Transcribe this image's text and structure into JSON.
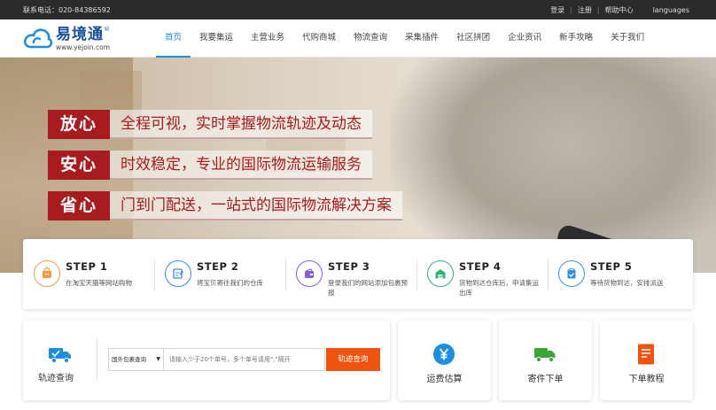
{
  "topbar": {
    "phone": "联系电话：020-84386592",
    "login": "登录",
    "register": "注册",
    "help": "帮助中心",
    "languages": "languages"
  },
  "logo": {
    "name": "易境通",
    "mark": "®",
    "url": "www.yejoin.com",
    "color": "#1c4f9c"
  },
  "nav": {
    "active_color": "#1c8fe3",
    "items": [
      {
        "label": "首页",
        "active": true
      },
      {
        "label": "我要集运"
      },
      {
        "label": "主营业务"
      },
      {
        "label": "代购商城"
      },
      {
        "label": "物流查询"
      },
      {
        "label": "采集插件"
      },
      {
        "label": "社区拼团"
      },
      {
        "label": "企业资讯"
      },
      {
        "label": "新手攻略"
      },
      {
        "label": "关于我们"
      }
    ]
  },
  "hero": {
    "tag_color": "#a81b1e",
    "slogans": [
      {
        "tag": "放心",
        "text": "全程可视，实时掌握物流轨迹及动态"
      },
      {
        "tag": "安心",
        "text": "时效稳定，专业的国际物流运输服务"
      },
      {
        "tag": "省心",
        "text": "门到门配送，一站式的国际物流解决方案"
      }
    ]
  },
  "steps": [
    {
      "title": "STEP 1",
      "desc": "在淘宝天猫等网站购物",
      "icon": "shopping-bag-icon",
      "color": "#f39a3c"
    },
    {
      "title": "STEP 2",
      "desc": "将宝贝寄往我们的仓库",
      "icon": "edit-form-icon",
      "color": "#3b8be0"
    },
    {
      "title": "STEP 3",
      "desc": "登录我们的网站添加包裹预报",
      "icon": "wallet-icon",
      "color": "#8a5bd6"
    },
    {
      "title": "STEP 4",
      "desc": "货物到达仓库后，申请集运出库",
      "icon": "warehouse-icon",
      "color": "#2bb673"
    },
    {
      "title": "STEP 5",
      "desc": "等待货物到达，安排派送",
      "icon": "clipboard-check-icon",
      "color": "#2f8fe6"
    }
  ],
  "track": {
    "label": "轨迹查询",
    "select_value": "国外包裹查询",
    "input_placeholder": "请输入少于20个单号，多个单号请用\",\"隔开",
    "button": "轨迹查询",
    "button_color": "#f0530d"
  },
  "cards": [
    {
      "label": "运费估算",
      "icon": "yen-coin-icon",
      "color": "#1c8fe3"
    },
    {
      "label": "寄件下单",
      "icon": "delivery-truck-icon",
      "color": "#3aa63a"
    },
    {
      "label": "下单教程",
      "icon": "document-icon",
      "color": "#f0530d"
    }
  ]
}
